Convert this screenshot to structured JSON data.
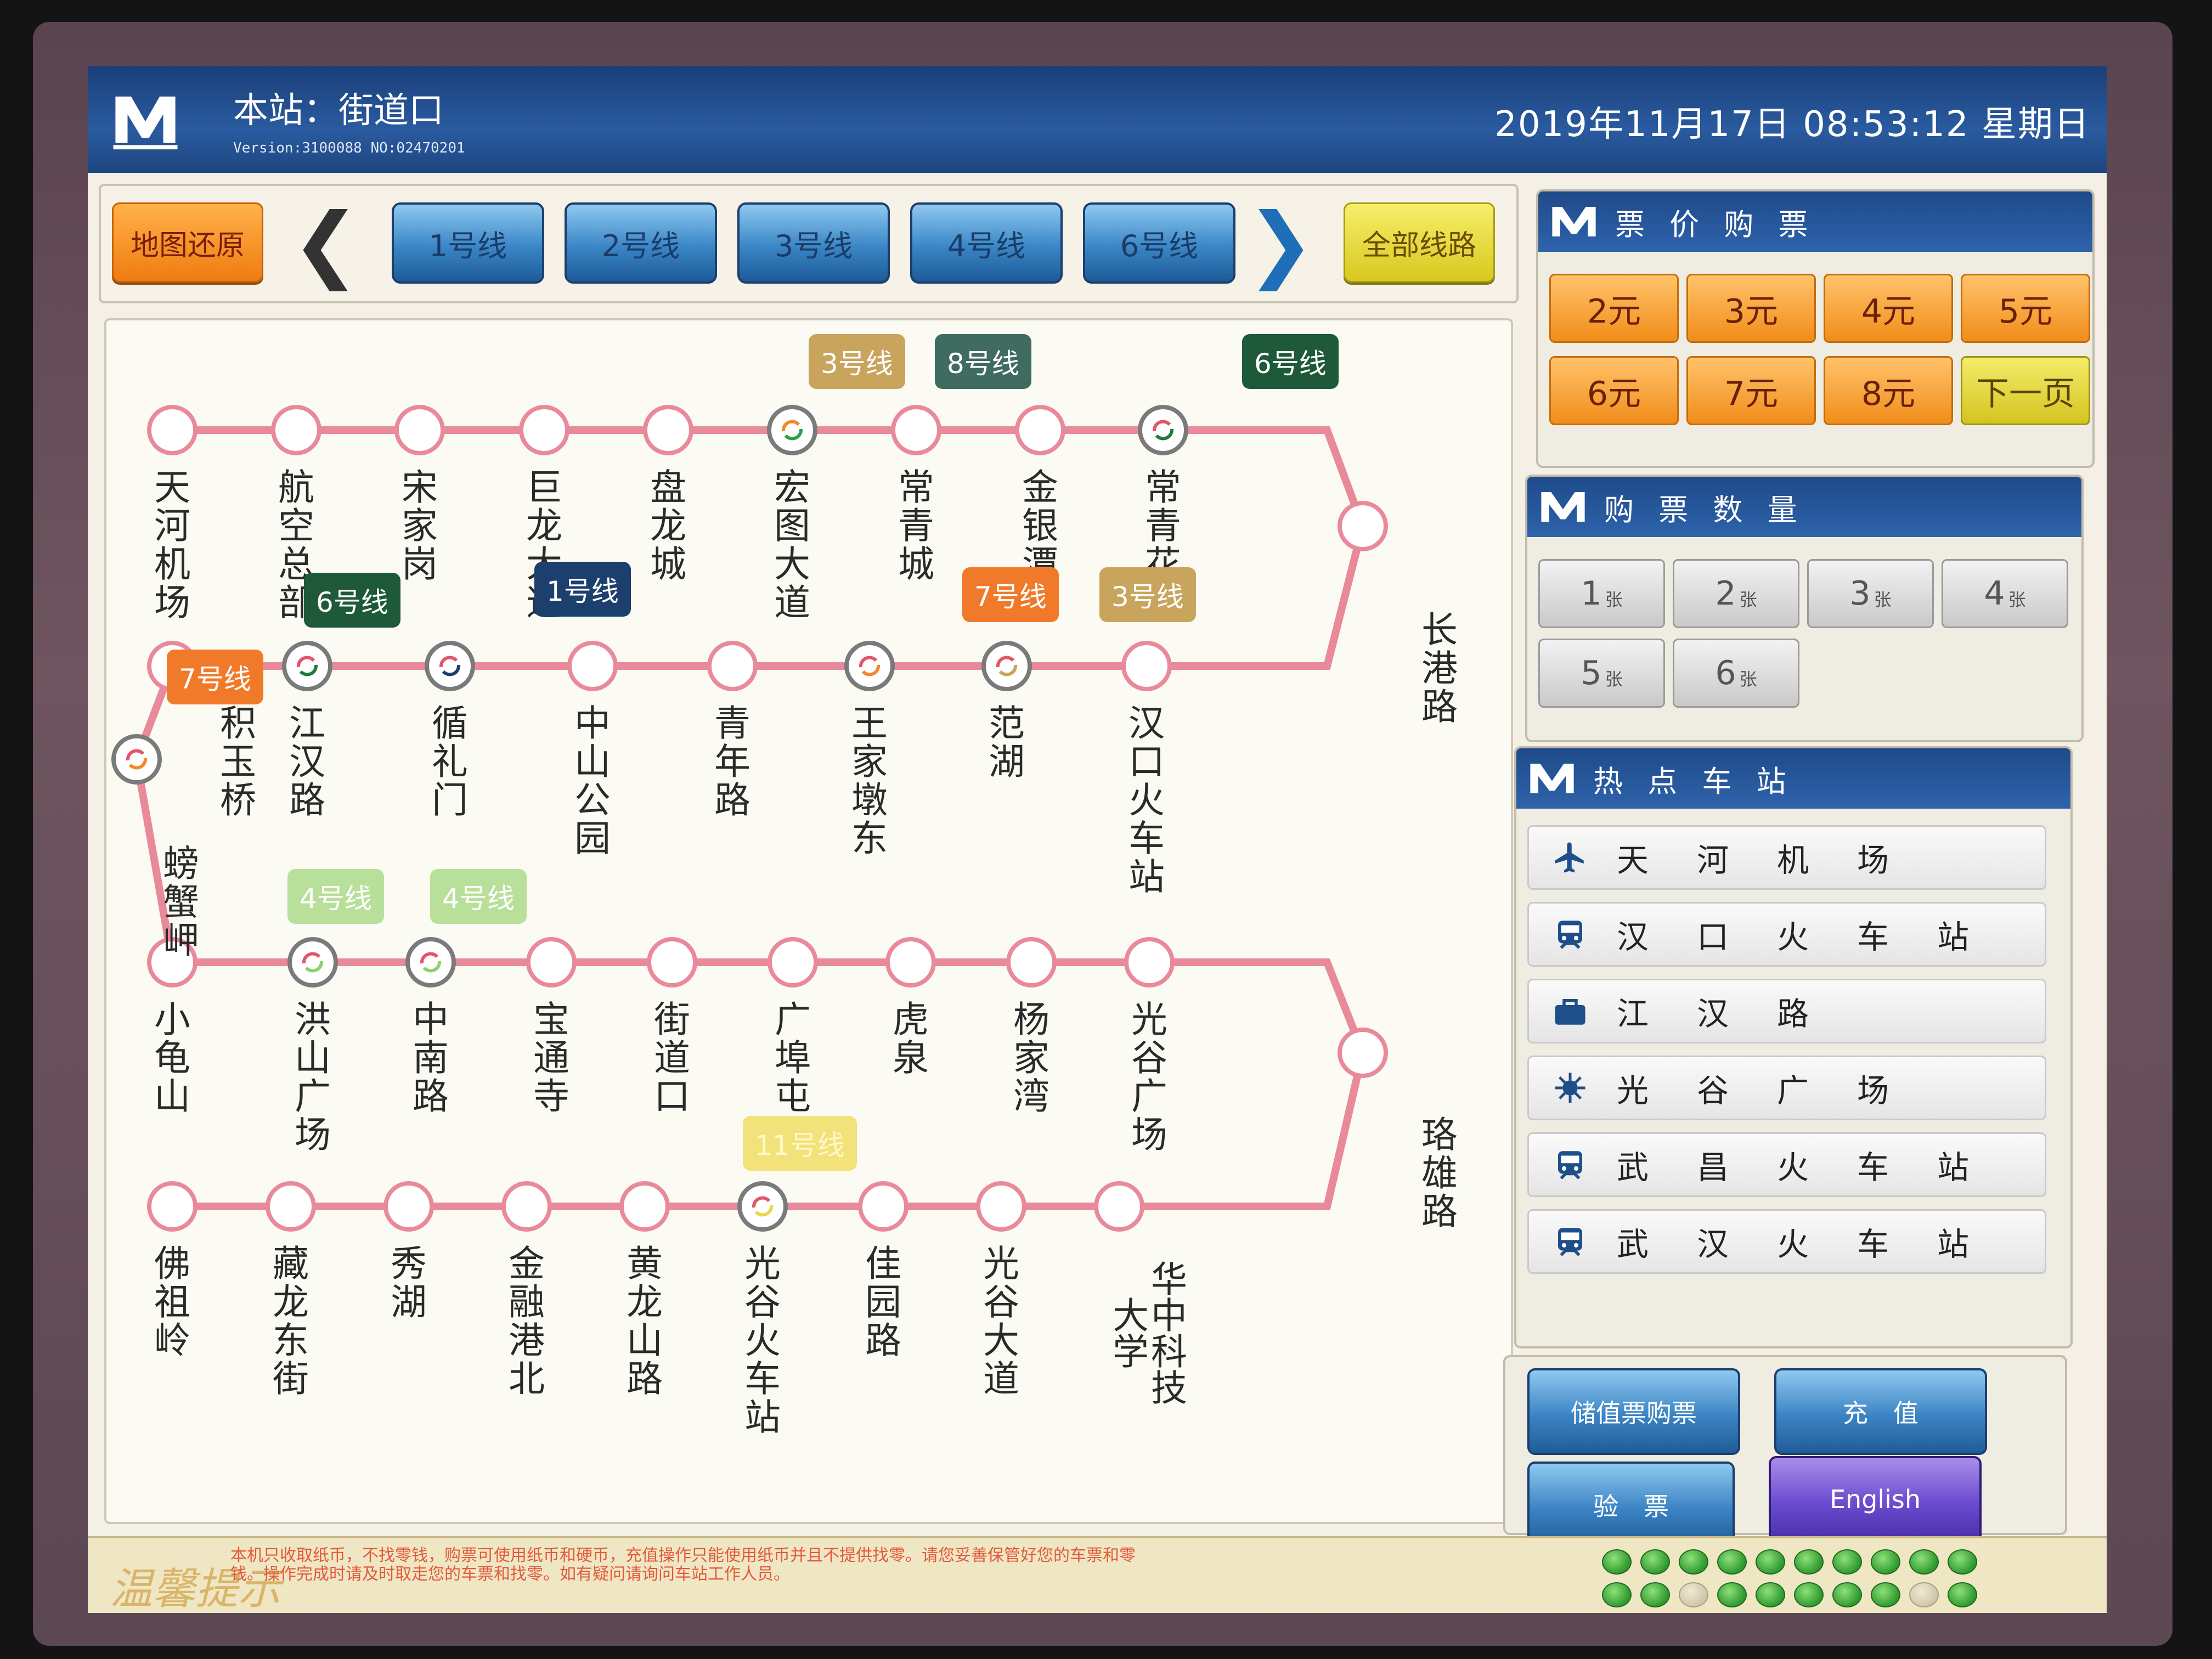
{
  "header": {
    "station": "本站：街道口",
    "version": "Version:3100088   NO:02470201",
    "datetime": "2019年11月17日  08:53:12  星期日"
  },
  "linebar": {
    "reset": "地图还原",
    "lines": [
      "1号线",
      "2号线",
      "3号线",
      "4号线",
      "6号线"
    ],
    "all": "全部线路"
  },
  "map": {
    "row1": [
      "天河机场",
      "航空总部",
      "宋家岗",
      "巨龙大道",
      "盘龙城",
      "宏图大道",
      "常青城",
      "金银潭",
      "常青花园"
    ],
    "row2": [
      "积玉桥",
      "江汉路",
      "循礼门",
      "中山公园",
      "青年路",
      "王家墩东",
      "范湖",
      "汉口火车站"
    ],
    "row2_left": "螃蟹岬",
    "row3": [
      "小龟山",
      "洪山广场",
      "中南路",
      "宝通寺",
      "街道口",
      "广埠屯",
      "虎泉",
      "杨家湾",
      "光谷广场"
    ],
    "row4": [
      "佛祖岭",
      "藏龙东街",
      "秀湖",
      "金融港北",
      "黄龙山路",
      "光谷火车站",
      "佳园路",
      "光谷大道",
      "华中科技大学"
    ],
    "trail_right_top": "长港路",
    "trail_right_bottom": "珞雄路",
    "badges": {
      "b3a": "3号线",
      "b8": "8号线",
      "b6a": "6号线",
      "b6b": "6号线",
      "b1": "1号线",
      "b7a": "7号线",
      "b3b": "3号线",
      "b7b": "7号线",
      "b4a": "4号线",
      "b4b": "4号线",
      "b11": "11号线"
    },
    "colors": {
      "line2": "#e98a9a",
      "transfer_ring": "#7a7a7a"
    }
  },
  "fare": {
    "title": "票 价 购 票",
    "prices": [
      "2元",
      "3元",
      "4元",
      "5元",
      "6元",
      "7元",
      "8元"
    ],
    "next": "下一页"
  },
  "quantity": {
    "title": "购 票 数 量",
    "options": [
      "1",
      "2",
      "3",
      "4",
      "5",
      "6"
    ],
    "unit": "张"
  },
  "hot": {
    "title": "热 点 车 站",
    "stations": [
      {
        "name": "天河机场",
        "icon": "airplane-icon"
      },
      {
        "name": "汉口火车站",
        "icon": "train-icon"
      },
      {
        "name": "江汉路",
        "icon": "shopping-bag-icon"
      },
      {
        "name": "光谷广场",
        "icon": "compass-icon"
      },
      {
        "name": "武昌火车站",
        "icon": "train-icon"
      },
      {
        "name": "武汉火车站",
        "icon": "train-icon"
      }
    ]
  },
  "actions": {
    "stored_value": "储值票购票",
    "recharge": "充　值",
    "check": "验　票",
    "english": "English"
  },
  "footer": {
    "tip": "温馨提示",
    "notice": "本机只收取纸币，不找零钱，购票可使用纸币和硬币，充值操作只能使用纸币并且不提供找零。请您妥善保管好您的车票和零钱。操作完成时请及时取走您的车票和找零。如有疑问请询问车站工作人员。"
  }
}
